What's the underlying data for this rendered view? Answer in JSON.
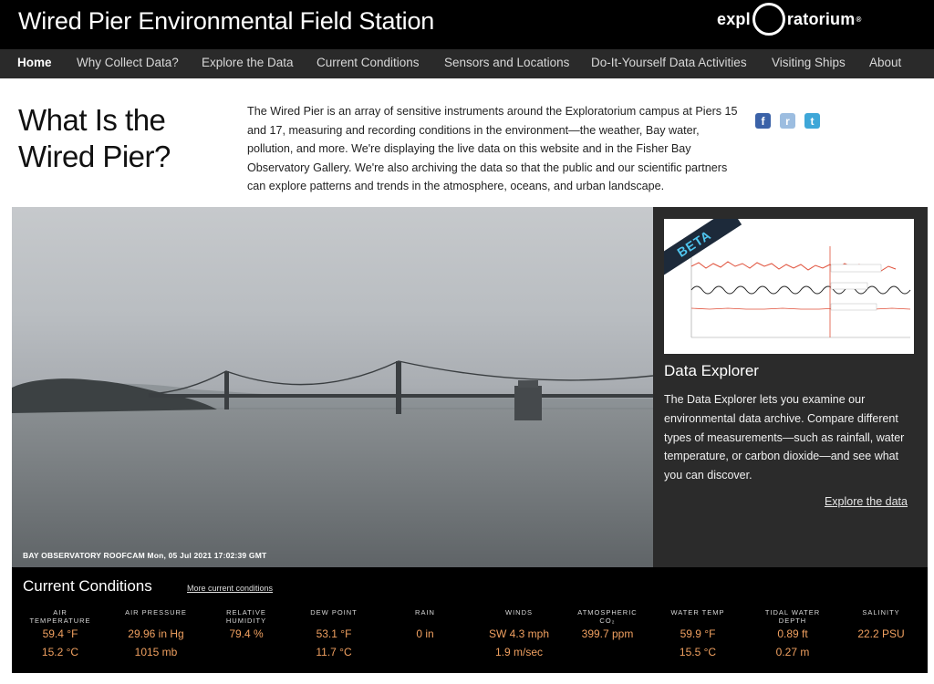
{
  "header": {
    "site_title": "Wired Pier Environmental Field Station",
    "logo_left": "expl",
    "logo_right": "ratorium",
    "logo_mark": "®"
  },
  "nav": {
    "items": [
      {
        "label": "Home",
        "active": true
      },
      {
        "label": "Why Collect Data?"
      },
      {
        "label": "Explore the Data"
      },
      {
        "label": "Current Conditions"
      },
      {
        "label": "Sensors and Locations"
      },
      {
        "label": "Do-It-Yourself Data Activities"
      },
      {
        "label": "Visiting Ships"
      },
      {
        "label": "About"
      }
    ]
  },
  "intro": {
    "heading": "What Is the Wired Pier?",
    "text": "The Wired Pier is an array of sensitive instruments around the Exploratorium campus at Piers 15 and 17, measuring and recording conditions in the environment—the weather, Bay water, pollution, and more. We're displaying the live data on this website and in the Fisher Bay Observatory Gallery. We're also archiving the data so that the public and our scientific partners can explore patterns and trends in the atmosphere, oceans, and urban landscape."
  },
  "social": {
    "facebook_glyph": "f",
    "reddit_glyph": "r",
    "twitter_glyph": "t"
  },
  "hero": {
    "caption": "BAY OBSERVATORY ROOFCAM Mon, 05 Jul 2021 17:02:39 GMT"
  },
  "explorer": {
    "badge": "BETA",
    "title": "Data Explorer",
    "text": "The Data Explorer lets you examine our environmental data archive. Compare different types of measurements—such as rainfall, water temperature, or carbon dioxide—and see what you can discover.",
    "link": "Explore the data"
  },
  "conditions": {
    "title": "Current Conditions",
    "more_link": "More current conditions",
    "metrics": [
      {
        "label": "AIR TEMPERATURE",
        "v1": "59.4 °F",
        "v2": "15.2 °C"
      },
      {
        "label": "AIR PRESSURE",
        "v1": "29.96 in Hg",
        "v2": "1015 mb"
      },
      {
        "label": "RELATIVE HUMIDITY",
        "v1": "79.4 %",
        "v2": ""
      },
      {
        "label": "DEW POINT",
        "v1": "53.1 °F",
        "v2": "11.7 °C"
      },
      {
        "label": "RAIN",
        "v1": "0 in",
        "v2": ""
      },
      {
        "label": "WINDS",
        "v1": "SW 4.3 mph",
        "v2": "1.9 m/sec"
      },
      {
        "label": "ATMOSPHERIC CO₂",
        "v1": "399.7 ppm",
        "v2": ""
      },
      {
        "label": "WATER TEMP",
        "v1": "59.9 °F",
        "v2": "15.5 °C"
      },
      {
        "label": "TIDAL WATER DEPTH",
        "v1": "0.89 ft",
        "v2": "0.27 m"
      },
      {
        "label": "SALINITY",
        "v1": "22.2 PSU",
        "v2": ""
      }
    ]
  },
  "colors": {
    "accent_orange": "#f0a060",
    "header_bg": "#000000",
    "nav_bg": "#2a2a2a"
  }
}
